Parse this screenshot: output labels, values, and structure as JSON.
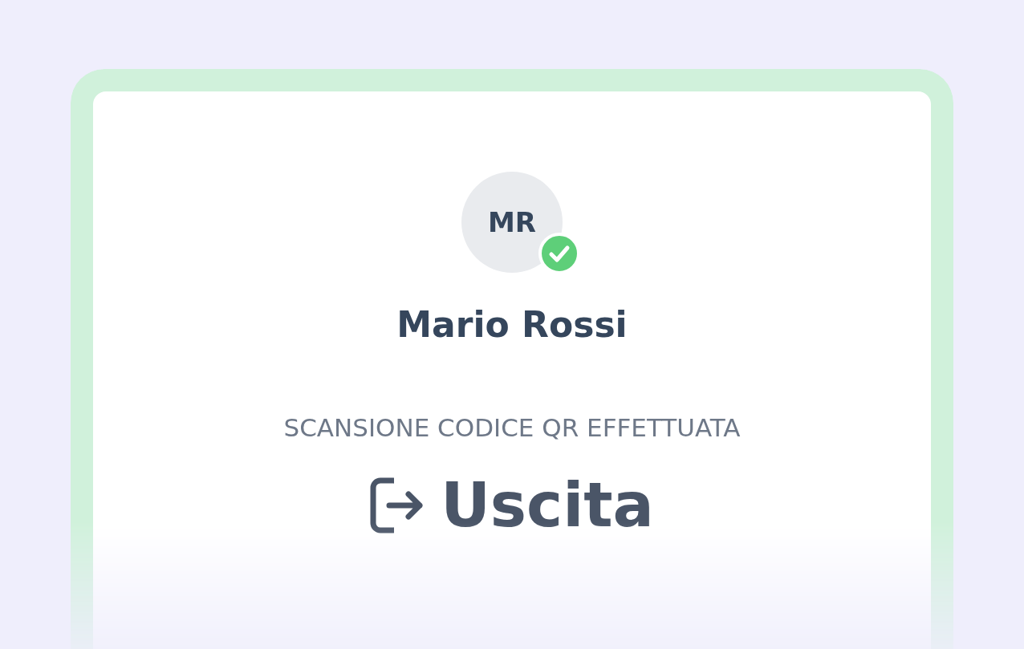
{
  "person": {
    "initials": "MR",
    "name": "Mario Rossi",
    "verified": true
  },
  "status": "SCANSIONE CODICE QR EFFETTUATA",
  "action": {
    "kind": "exit",
    "label": "Uscita"
  }
}
